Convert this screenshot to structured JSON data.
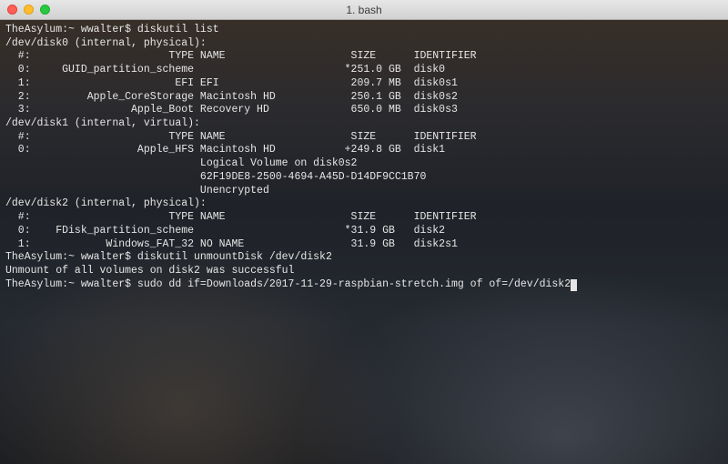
{
  "window": {
    "title": "1. bash"
  },
  "prompt": {
    "host": "TheAsylum",
    "user": "wwalter"
  },
  "commands": {
    "cmd1": "diskutil list",
    "cmd2": "diskutil unmountDisk /dev/disk2",
    "cmd2_result": "Unmount of all volumes on disk2 was successful",
    "cmd3": "sudo dd if=Downloads/2017-11-29-raspbian-stretch.img of of=/dev/disk2"
  },
  "headers": {
    "num": "#:",
    "type": "TYPE",
    "name": "NAME",
    "size": "SIZE",
    "identifier": "IDENTIFIER"
  },
  "disks": [
    {
      "device": "/dev/disk0",
      "attrs": "(internal, physical)",
      "partitions": [
        {
          "num": "0:",
          "type": "GUID_partition_scheme",
          "name": "",
          "size": "*251.0 GB",
          "identifier": "disk0"
        },
        {
          "num": "1:",
          "type": "EFI",
          "name": "EFI",
          "size": "209.7 MB",
          "identifier": "disk0s1"
        },
        {
          "num": "2:",
          "type": "Apple_CoreStorage",
          "name": "Macintosh HD",
          "size": "250.1 GB",
          "identifier": "disk0s2"
        },
        {
          "num": "3:",
          "type": "Apple_Boot",
          "name": "Recovery HD",
          "size": "650.0 MB",
          "identifier": "disk0s3"
        }
      ]
    },
    {
      "device": "/dev/disk1",
      "attrs": "(internal, virtual)",
      "partitions": [
        {
          "num": "0:",
          "type": "Apple_HFS",
          "name": "Macintosh HD",
          "size": "+249.8 GB",
          "identifier": "disk1"
        }
      ],
      "extra": [
        "Logical Volume on disk0s2",
        "62F19DE8-2500-4694-A45D-D14DF9CC1B70",
        "Unencrypted"
      ]
    },
    {
      "device": "/dev/disk2",
      "attrs": "(internal, physical)",
      "partitions": [
        {
          "num": "0:",
          "type": "FDisk_partition_scheme",
          "name": "",
          "size": "*31.9 GB",
          "identifier": "disk2"
        },
        {
          "num": "1:",
          "type": "Windows_FAT_32",
          "name": "NO NAME",
          "size": "31.9 GB",
          "identifier": "disk2s1"
        }
      ]
    }
  ],
  "cols": {
    "num_pad": 4,
    "type_pad": 25,
    "name_start": 31,
    "size_start": 55,
    "id_start": 65,
    "extra_start": 31
  }
}
